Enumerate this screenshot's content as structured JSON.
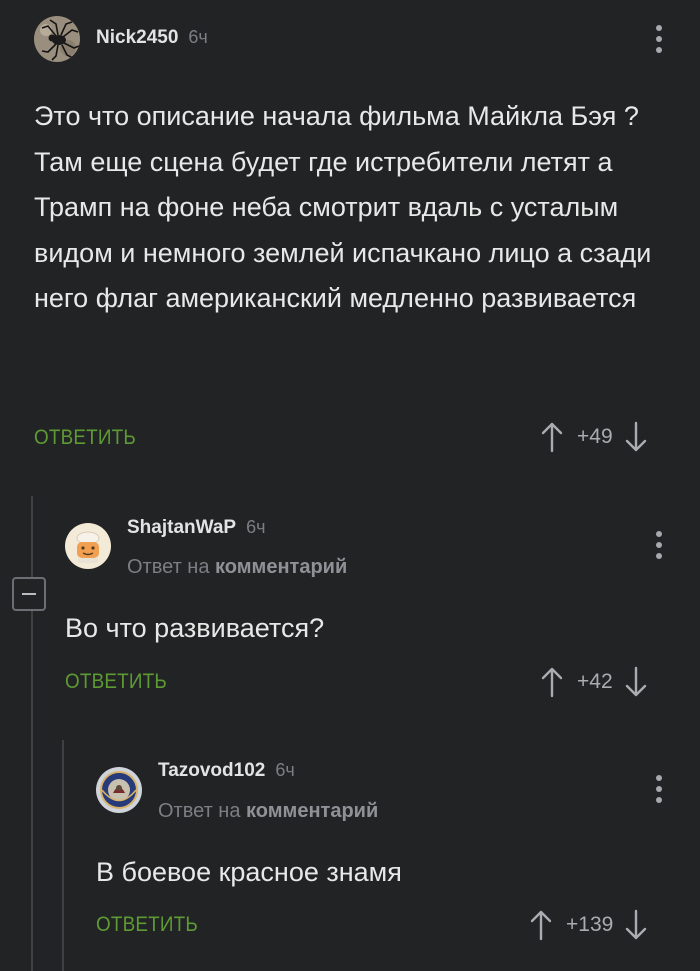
{
  "comments": [
    {
      "username": "Nick2450",
      "time": "6ч",
      "avatar_icon": "spider-avatar-icon",
      "body": "Это что описание начала фильма Майкла Бэя ? Там еще сцена будет где истребители летят а Трамп на фоне неба смотрит вдаль с усталым видом и немного землей испачкано лицо а сзади него флаг американский медленно развивается",
      "reply_label": "ОТВЕТИТЬ",
      "score": "+49"
    },
    {
      "username": "ShajtanWaP",
      "time": "6ч",
      "avatar_icon": "cartoon-face-avatar-icon",
      "reply_to_prefix": "Ответ на",
      "reply_to_target": "комментарий",
      "body": "Во что развивается?",
      "reply_label": "ОТВЕТИТЬ",
      "score": "+42"
    },
    {
      "username": "Tazovod102",
      "time": "6ч",
      "avatar_icon": "emblem-avatar-icon",
      "reply_to_prefix": "Ответ на",
      "reply_to_target": "комментарий",
      "body": "В боевое красное знамя",
      "reply_label": "ОТВЕТИТЬ",
      "score": "+139"
    }
  ],
  "colors": {
    "background": "#222325",
    "reply_green": "#5e9a34",
    "muted_text": "#7b7e83",
    "thread_line": "#3e4044"
  }
}
